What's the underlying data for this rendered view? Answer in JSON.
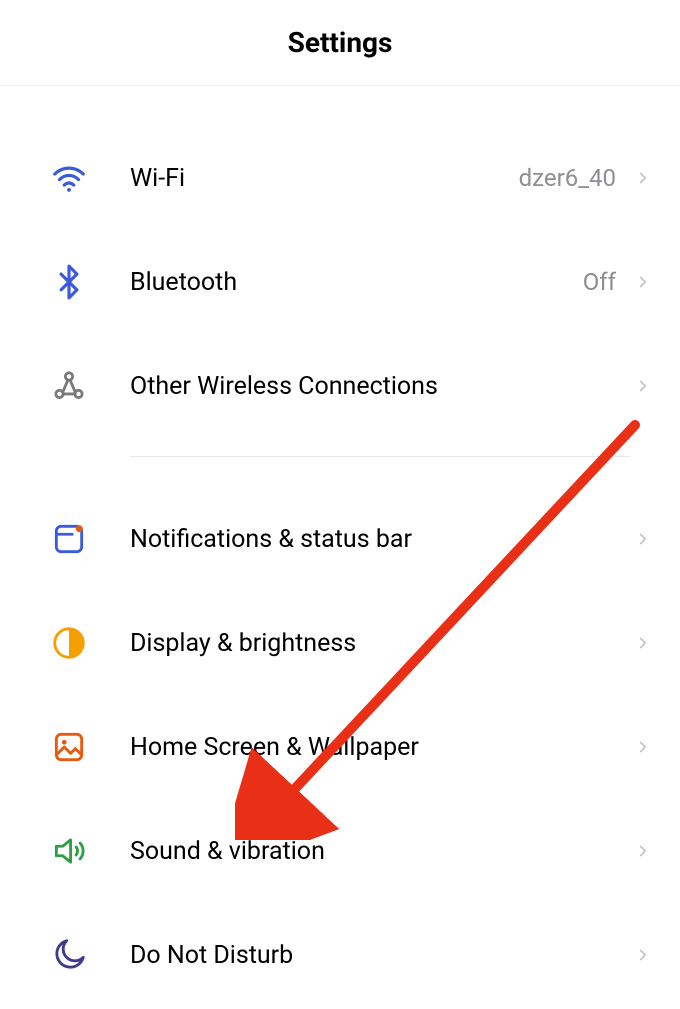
{
  "header": {
    "title": "Settings"
  },
  "groups": [
    {
      "items": [
        {
          "key": "wifi",
          "label": "Wi-Fi",
          "value": "dzer6_40"
        },
        {
          "key": "bluetooth",
          "label": "Bluetooth",
          "value": "Off"
        },
        {
          "key": "other_wireless",
          "label": "Other Wireless Connections",
          "value": ""
        }
      ]
    },
    {
      "items": [
        {
          "key": "notifications",
          "label": "Notifications & status bar",
          "value": ""
        },
        {
          "key": "display",
          "label": "Display & brightness",
          "value": ""
        },
        {
          "key": "home_wallpaper",
          "label": "Home Screen & Wallpaper",
          "value": ""
        },
        {
          "key": "sound",
          "label": "Sound & vibration",
          "value": ""
        },
        {
          "key": "dnd",
          "label": "Do Not Disturb",
          "value": ""
        }
      ]
    }
  ],
  "annotation": {
    "arrow_color": "#ea2f17"
  }
}
